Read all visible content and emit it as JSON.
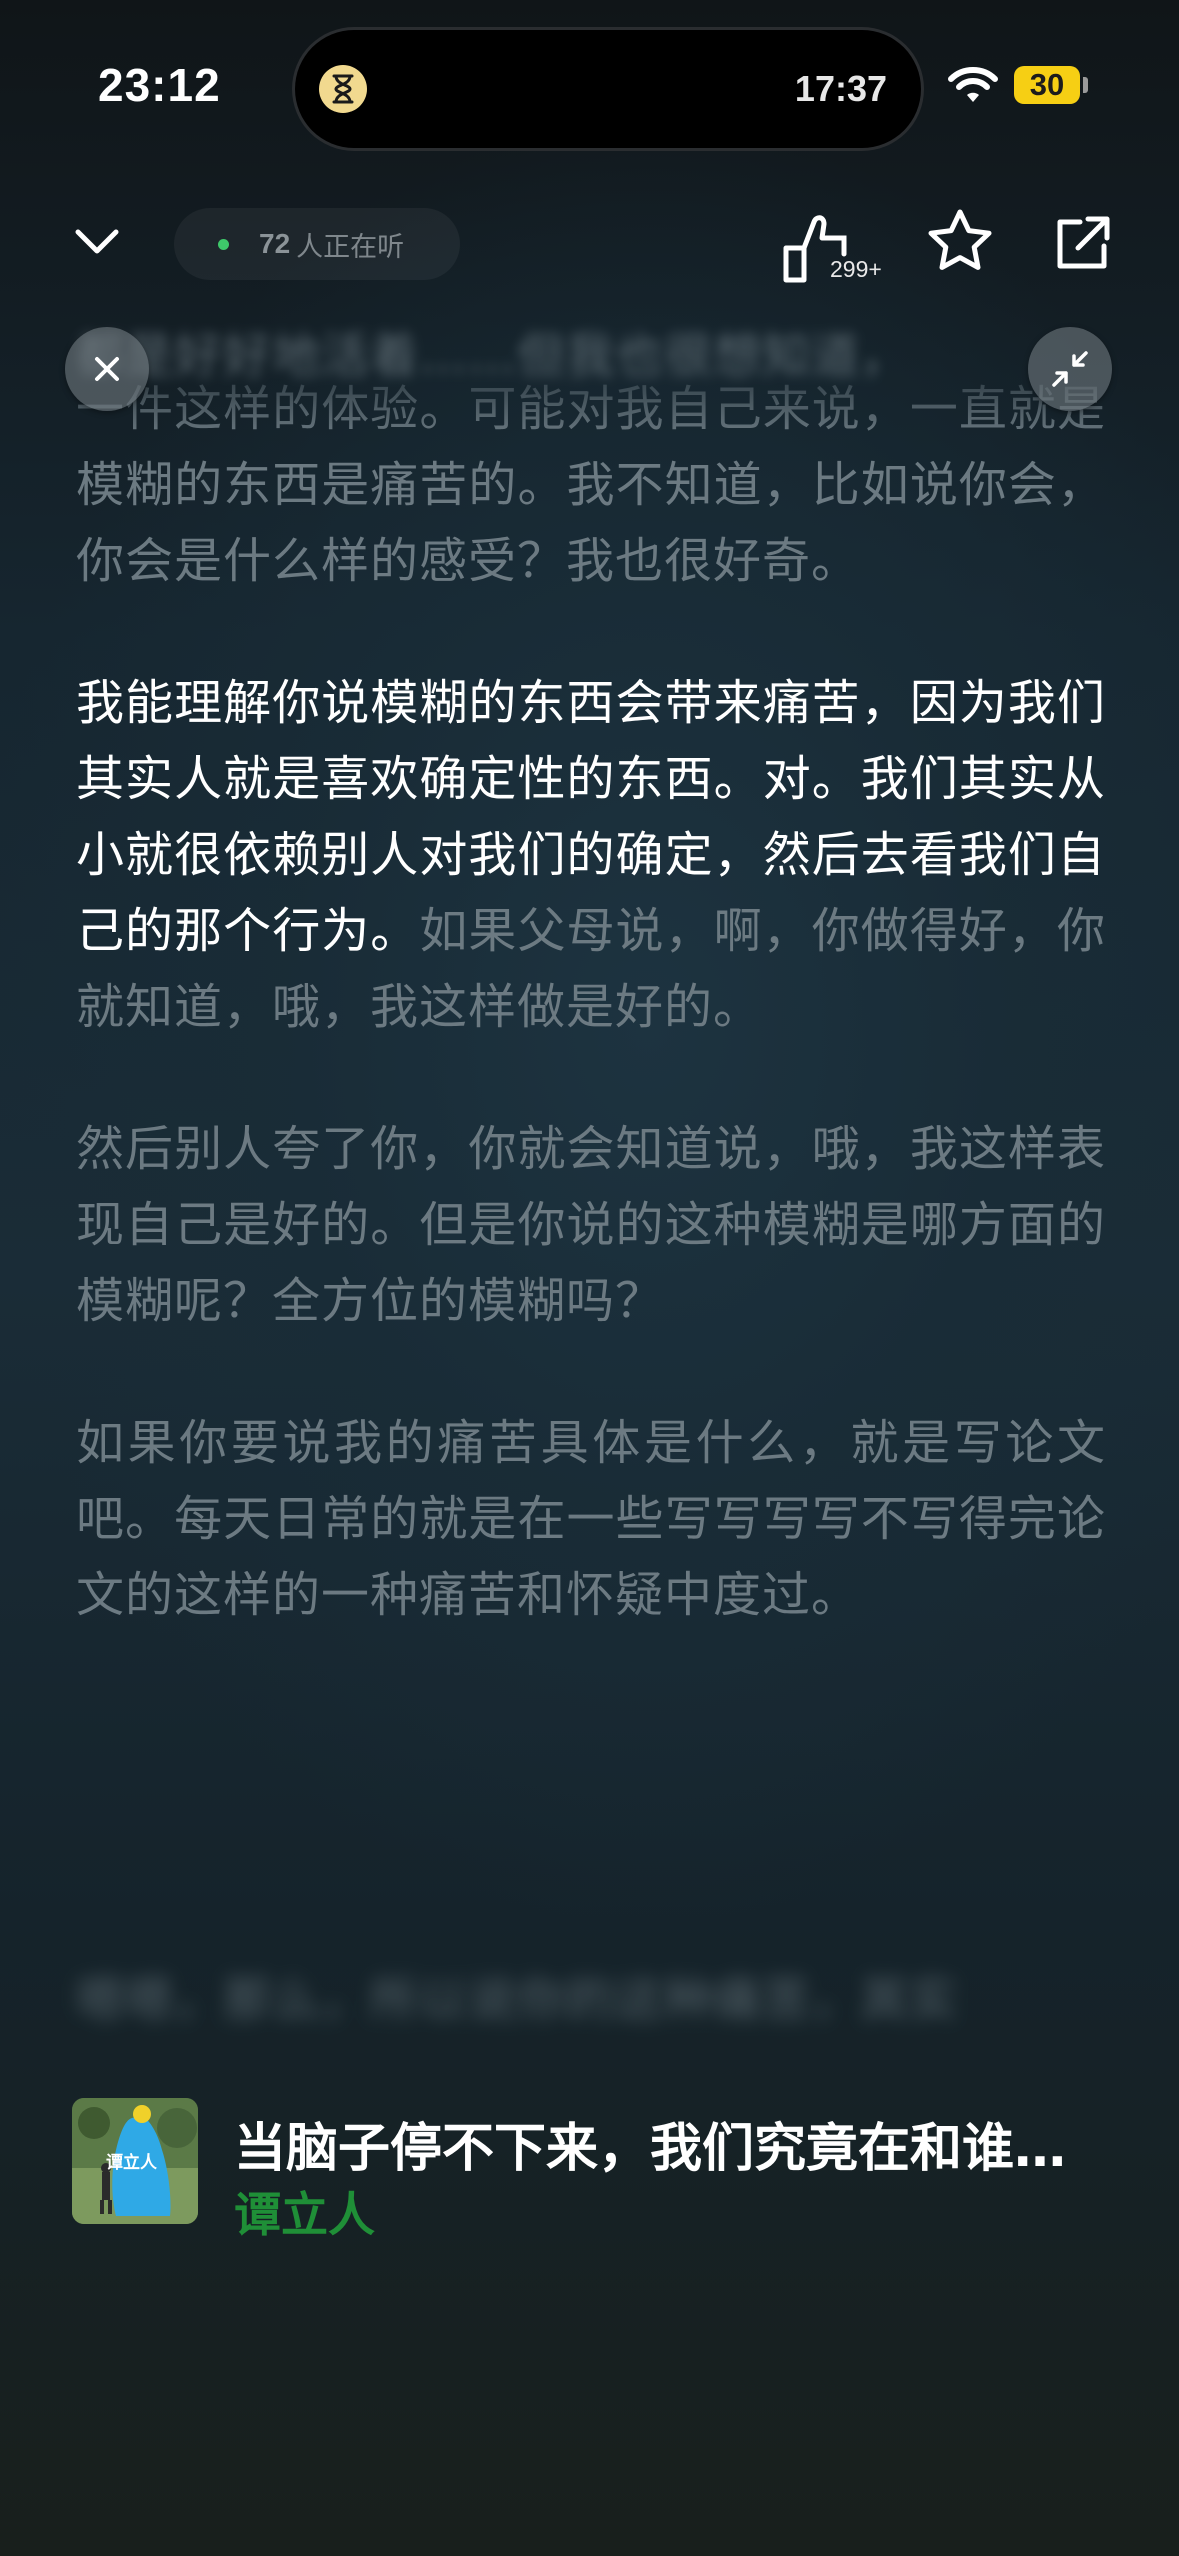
{
  "status_bar": {
    "time": "23:12",
    "island_time": "17:37",
    "battery": "30"
  },
  "toolbar": {
    "listeners_count": "72",
    "listeners_label": "人正在听",
    "like_count": "299+"
  },
  "transcript": {
    "blurred_top": "都是好好地活着……但我也很想知道，",
    "paragraphs": [
      {
        "id": "p0",
        "state": "past",
        "text": "一件这样的体验。可能对我自己来说，一直就是模糊的东西是痛苦的。我不知道，比如说你会，你会是什么样的感受？我也很好奇。"
      },
      {
        "id": "p1",
        "state": "current",
        "spoken": "我能理解你说模糊的东西会带来痛苦，因为我们其实人就是喜欢确定性的东西。对。我们其实从小就很依赖别人对我们的确定，然后去看我们自己的那个行为。",
        "upcoming": "如果父母说，啊，你做得好，你就知道，哦，我这样做是好的。"
      },
      {
        "id": "p2",
        "state": "future",
        "text": "然后别人夸了你，你就会知道说，哦，我这样表现自己是好的。但是你说的这种模糊是哪方面的模糊呢？全方位的模糊吗？"
      },
      {
        "id": "p3",
        "state": "future",
        "text": "如果你要说我的痛苦具体是什么，就是写论文吧。每天日常的就是在一些写写写写不写得完论文的这样的一种痛苦和怀疑中度过。"
      }
    ],
    "blurred_bottom": "嗯嗯，那么，所以说你的这种痛苦，其实"
  },
  "episode": {
    "title": "当脑子停不下来，我们究竟在和谁…",
    "author": "谭立人",
    "cover_text": "谭立人"
  },
  "colors": {
    "accent_green": "#1f8f37",
    "battery_yellow": "#f6cf14",
    "live_dot": "#3ec86a"
  }
}
